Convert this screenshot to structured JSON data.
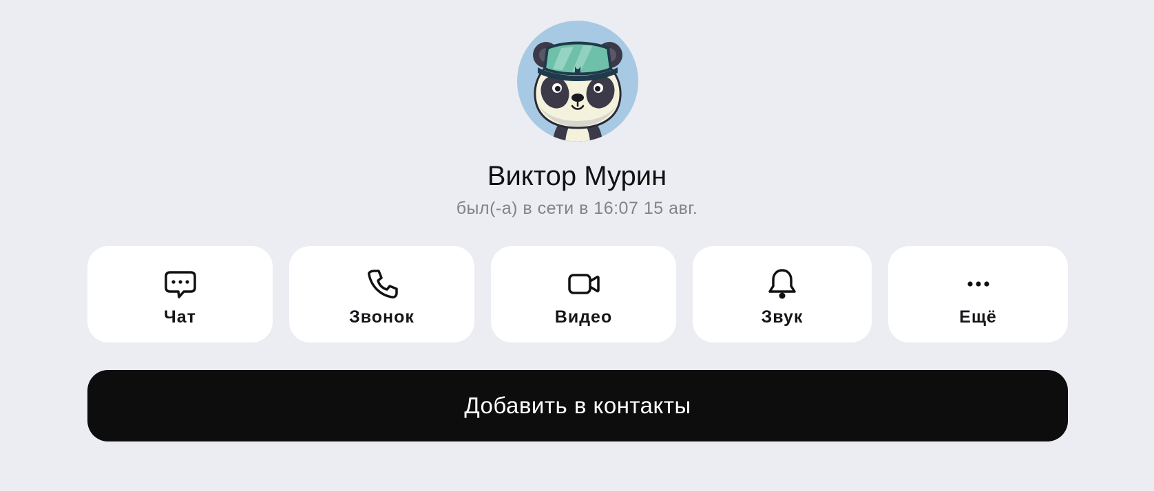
{
  "profile": {
    "avatar_icon": "panda-avatar-icon",
    "name": "Виктор Мурин",
    "status": "был(-а) в сети в 16:07 15 авг."
  },
  "actions": [
    {
      "label": "Чат",
      "icon": "chat-bubble-icon"
    },
    {
      "label": "Звонок",
      "icon": "phone-icon"
    },
    {
      "label": "Видео",
      "icon": "video-camera-icon"
    },
    {
      "label": "Звук",
      "icon": "bell-icon"
    },
    {
      "label": "Ещё",
      "icon": "more-dots-icon"
    }
  ],
  "add_contact": {
    "label": "Добавить в контакты"
  },
  "colors": {
    "background": "#ecedf2",
    "card": "#ffffff",
    "primary_button": "#0d0d0e",
    "avatar_bg": "#a7c9e4",
    "secondary_text": "#828389"
  }
}
